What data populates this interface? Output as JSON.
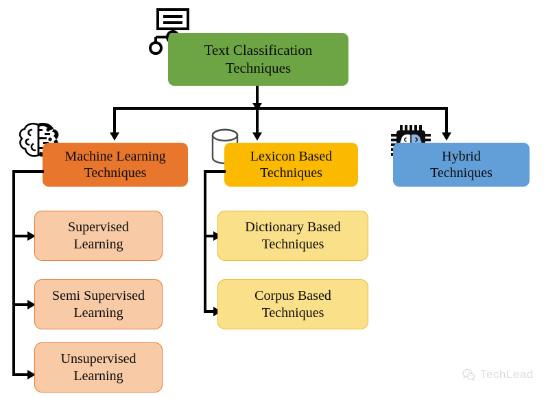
{
  "diagram": {
    "title": "Text Classification Techniques",
    "root": {
      "label": "Text Classification\nTechniques",
      "color": "#6DA544",
      "icon": "hierarchy-icon"
    },
    "branches": [
      {
        "id": "machine-learning",
        "label": "Machine Learning\nTechniques",
        "color": "#E8762C",
        "icon": "brain-icon",
        "children": [
          {
            "id": "supervised-learning",
            "label": "Supervised\nLearning",
            "fill": "#F8CBA6",
            "border": "#E8762C"
          },
          {
            "id": "semi-supervised-learning",
            "label": "Semi Supervised\nLearning",
            "fill": "#F8CBA6",
            "border": "#E8762C"
          },
          {
            "id": "unsupervised-learning",
            "label": "Unsupervised\nLearning",
            "fill": "#F8CBA6",
            "border": "#E8762C"
          }
        ]
      },
      {
        "id": "lexicon-based",
        "label": "Lexicon Based\nTechniques",
        "color": "#FBBA00",
        "icon": "database-icon",
        "children": [
          {
            "id": "dictionary-based-techniques",
            "label": "Dictionary Based\nTechniques",
            "fill": "#FBE08A",
            "border": "#F0B323"
          },
          {
            "id": "corpus-based-techniques",
            "label": "Corpus Based\nTechniques",
            "fill": "#FBE08A",
            "border": "#F0B323"
          }
        ]
      },
      {
        "id": "hybrid",
        "label": "Hybrid\nTechniques",
        "color": "#629FD8",
        "icon": "chip-brain-icon",
        "children": []
      }
    ]
  },
  "watermark": {
    "text": "TechLead",
    "icon": "wechat-logo-icon"
  }
}
